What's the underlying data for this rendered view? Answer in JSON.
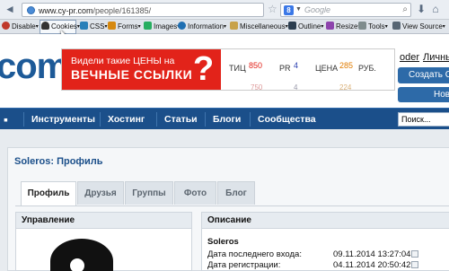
{
  "browser": {
    "url_host": "www.cy-pr.com",
    "url_path": "/people/161385/",
    "search_placeholder": "Google",
    "search_engine_letter": "8"
  },
  "devbar": {
    "items": [
      {
        "label": "Disable",
        "icon_color": "#c0392b"
      },
      {
        "label": "Cookies",
        "icon_color": "#333333"
      },
      {
        "label": "CSS",
        "icon_color": "#2980b9"
      },
      {
        "label": "Forms",
        "icon_color": "#d68910"
      },
      {
        "label": "Images",
        "icon_color": "#27ae60"
      },
      {
        "label": "Information",
        "icon_color": "#1f6fb2"
      },
      {
        "label": "Miscellaneous",
        "icon_color": "#c8a24a"
      },
      {
        "label": "Outline",
        "icon_color": "#2c3e50"
      },
      {
        "label": "Resize",
        "icon_color": "#8e44ad"
      },
      {
        "label": "Tools",
        "icon_color": "#7f8c8d"
      },
      {
        "label": "View Source",
        "icon_color": "#566573"
      }
    ]
  },
  "site": {
    "logo": "com",
    "link_partial": "oder",
    "link_personal": "Личны",
    "btn_create": "Создать С",
    "btn_new": "Нов"
  },
  "ad": {
    "line1": "Видели такие ЦЕНЫ на",
    "line2": "ВЕЧНЫЕ ССЫЛКИ",
    "question": "?",
    "tic_label": "ТИЦ",
    "tic_value": "850",
    "pr_label": "PR",
    "pr_value": "4",
    "price_label": "ЦЕНА",
    "price_value": "285",
    "currency": "РУБ.",
    "sub1": "750",
    "sub2": "4",
    "sub3": "224"
  },
  "nav": {
    "items": [
      "Инструменты",
      "Хостинг",
      "Статьи",
      "Блоги",
      "Сообщества"
    ],
    "search_value": "Поиск..."
  },
  "profile": {
    "title": "Soleros: Профиль",
    "tabs": [
      "Профиль",
      "Друзья",
      "Группы",
      "Фото",
      "Блог"
    ],
    "left_box_title": "Управление",
    "right_box_title": "Описание",
    "username": "Soleros",
    "last_login_label": "Дата последнего входа:",
    "last_login_value": "09.11.2014 13:27:04",
    "registered_label": "Дата регистрации:",
    "registered_value": "04.11.2014 20:50:42"
  }
}
